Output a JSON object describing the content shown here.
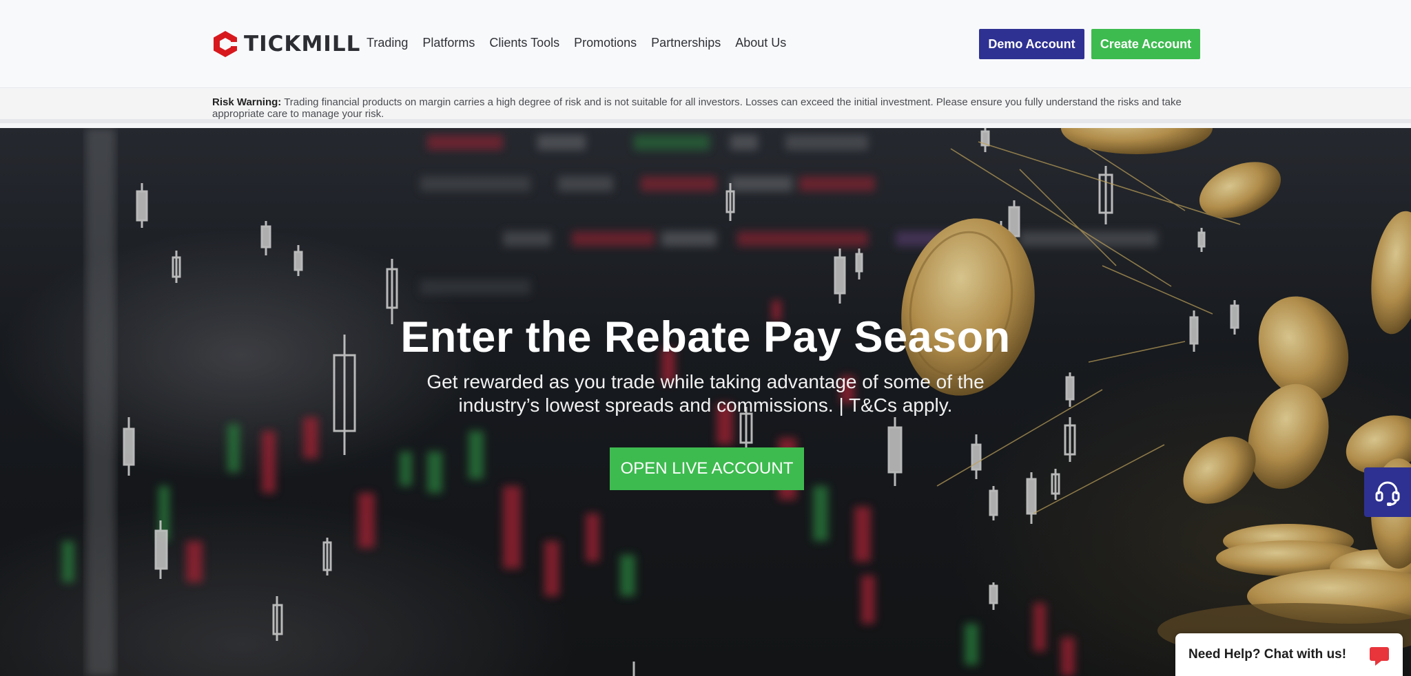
{
  "header": {
    "logo_text": "TICKMILL",
    "nav": [
      "Trading",
      "Platforms",
      "Clients Tools",
      "Promotions",
      "Partnerships",
      "About Us"
    ],
    "demo_button": "Demo Account",
    "create_button": "Create Account",
    "colors": {
      "demo": "#2e3192",
      "create": "#3dbb4f",
      "logo_red": "#d7191e"
    }
  },
  "risk_warning": {
    "label": "Risk Warning:",
    "text": "Trading financial products on margin carries a high degree of risk and is not suitable for all investors. Losses can exceed the initial investment. Please ensure you fully understand the risks and take appropriate care to manage your risk."
  },
  "hero": {
    "title": "Enter the Rebate Pay Season",
    "subtitle": "Get rewarded as you trade while taking advantage of some of the industry’s lowest spreads and commissions. | T&Cs apply.",
    "cta": "OPEN LIVE ACCOUNT"
  },
  "side_help": {
    "icon": "headset-icon"
  },
  "chat": {
    "label": "Need Help? Chat with us!",
    "icon": "chat-bubble-icon"
  }
}
